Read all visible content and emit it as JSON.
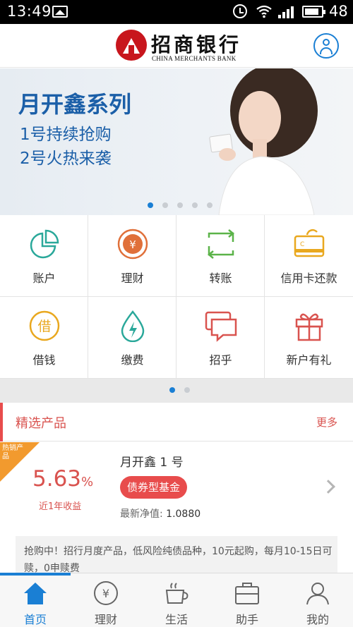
{
  "status_bar": {
    "time": "13:49",
    "battery": "48"
  },
  "header": {
    "brand_cn": "招商银行",
    "brand_en": "CHINA MERCHANTS BANK"
  },
  "banner": {
    "title": "月开鑫系列",
    "line1": "1号持续抢购",
    "line2": "2号火热来袭",
    "slide_count": 5,
    "active_slide": 1
  },
  "menu": {
    "items": [
      {
        "label": "账户",
        "icon": "pie-chart-icon"
      },
      {
        "label": "理财",
        "icon": "yuan-coin-icon"
      },
      {
        "label": "转账",
        "icon": "transfer-icon"
      },
      {
        "label": "信用卡还款",
        "icon": "credit-card-icon"
      },
      {
        "label": "借钱",
        "icon": "borrow-icon"
      },
      {
        "label": "缴费",
        "icon": "water-drop-icon"
      },
      {
        "label": "招乎",
        "icon": "chat-bubble-icon"
      },
      {
        "label": "新户有礼",
        "icon": "gift-icon"
      }
    ],
    "page_count": 2,
    "active_page": 1
  },
  "featured": {
    "title": "精选产品",
    "more": "更多",
    "product": {
      "hot_tag": "热销产品",
      "rate": "5.63",
      "rate_unit": "%",
      "rate_label": "近1年收益",
      "name": "月开鑫 1 号",
      "type": "债券型基金",
      "nav_label": "最新净值:",
      "nav_value": "1.0880"
    },
    "notice": "抢购中！招行月度产品，低风险纯债品种，10元起购，每月10-15日可赎，0申赎费"
  },
  "bottom_nav": {
    "items": [
      {
        "label": "首页",
        "icon": "home-icon",
        "active": true
      },
      {
        "label": "理财",
        "icon": "yuan-icon",
        "active": false
      },
      {
        "label": "生活",
        "icon": "coffee-icon",
        "active": false
      },
      {
        "label": "助手",
        "icon": "briefcase-icon",
        "active": false
      },
      {
        "label": "我的",
        "icon": "profile-icon",
        "active": false
      }
    ]
  },
  "colors": {
    "brand_red": "#c8161d",
    "accent_blue": "#1a7fd4",
    "highlight_red": "#e84c4c",
    "hot_orange": "#f29a2e"
  }
}
